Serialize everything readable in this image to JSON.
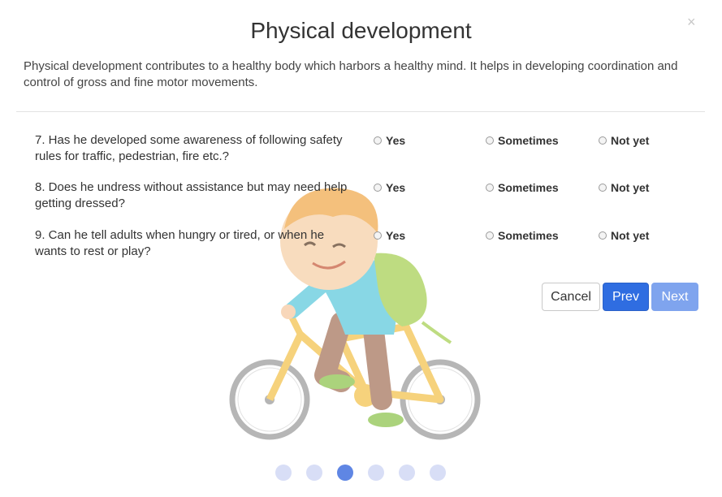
{
  "dialog": {
    "title": "Physical development",
    "description": "Physical development contributes to a healthy body which harbors a healthy mind. It helps in developing coordination and control of gross and fine motor movements.",
    "close_glyph": "×"
  },
  "options": [
    "Yes",
    "Sometimes",
    "Not yet"
  ],
  "questions": [
    {
      "text": "7. Has he developed some awareness of following safety rules for traffic, pedestrian, fire etc.?"
    },
    {
      "text": "8. Does he undress without assistance but may need help getting dressed?"
    },
    {
      "text": "9. Can he tell adults when hungry or tired, or when he wants to rest or play?"
    }
  ],
  "buttons": {
    "cancel": "Cancel",
    "prev": "Prev",
    "next": "Next"
  },
  "pagination": {
    "total": 6,
    "current": 3
  },
  "colors": {
    "primary": "#2f6de1",
    "primary_disabled": "#7fa4ee",
    "dot_active": "#5f86e4",
    "dot_inactive": "#d8def6"
  },
  "illustration": "boy-on-bicycle"
}
